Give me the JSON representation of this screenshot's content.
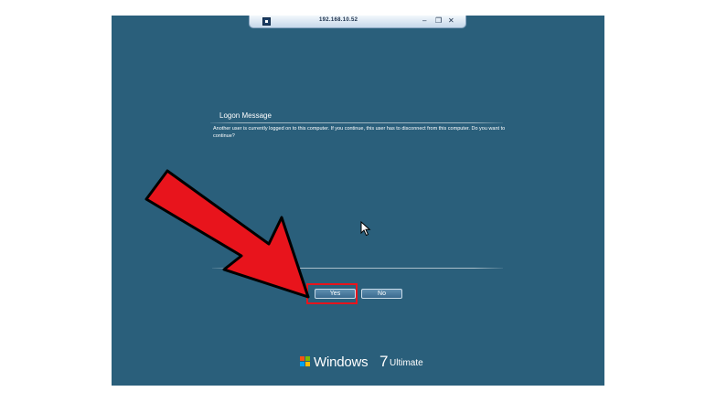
{
  "remote_bar": {
    "host": "192.168.10.52",
    "icons": [
      "pin-icon",
      "minimize-icon",
      "restore-icon",
      "close-icon"
    ],
    "minimize_glyph": "–",
    "restore_glyph": "❐",
    "close_glyph": "✕"
  },
  "dialog": {
    "title": "Logon Message",
    "message": "Another user is currently logged on to this computer. If you continue, this user has to disconnect from this computer. Do you want to continue?",
    "yes_label": "Yes",
    "no_label": "No"
  },
  "branding": {
    "product": "Windows",
    "version": "7",
    "edition": "Ultimate",
    "icon": "windows-flag-icon"
  },
  "annotation": {
    "icon": "red-arrow-icon",
    "color": "#e8141c"
  },
  "colors": {
    "desktop": "#2a5f7b",
    "highlight": "#e8141c"
  }
}
